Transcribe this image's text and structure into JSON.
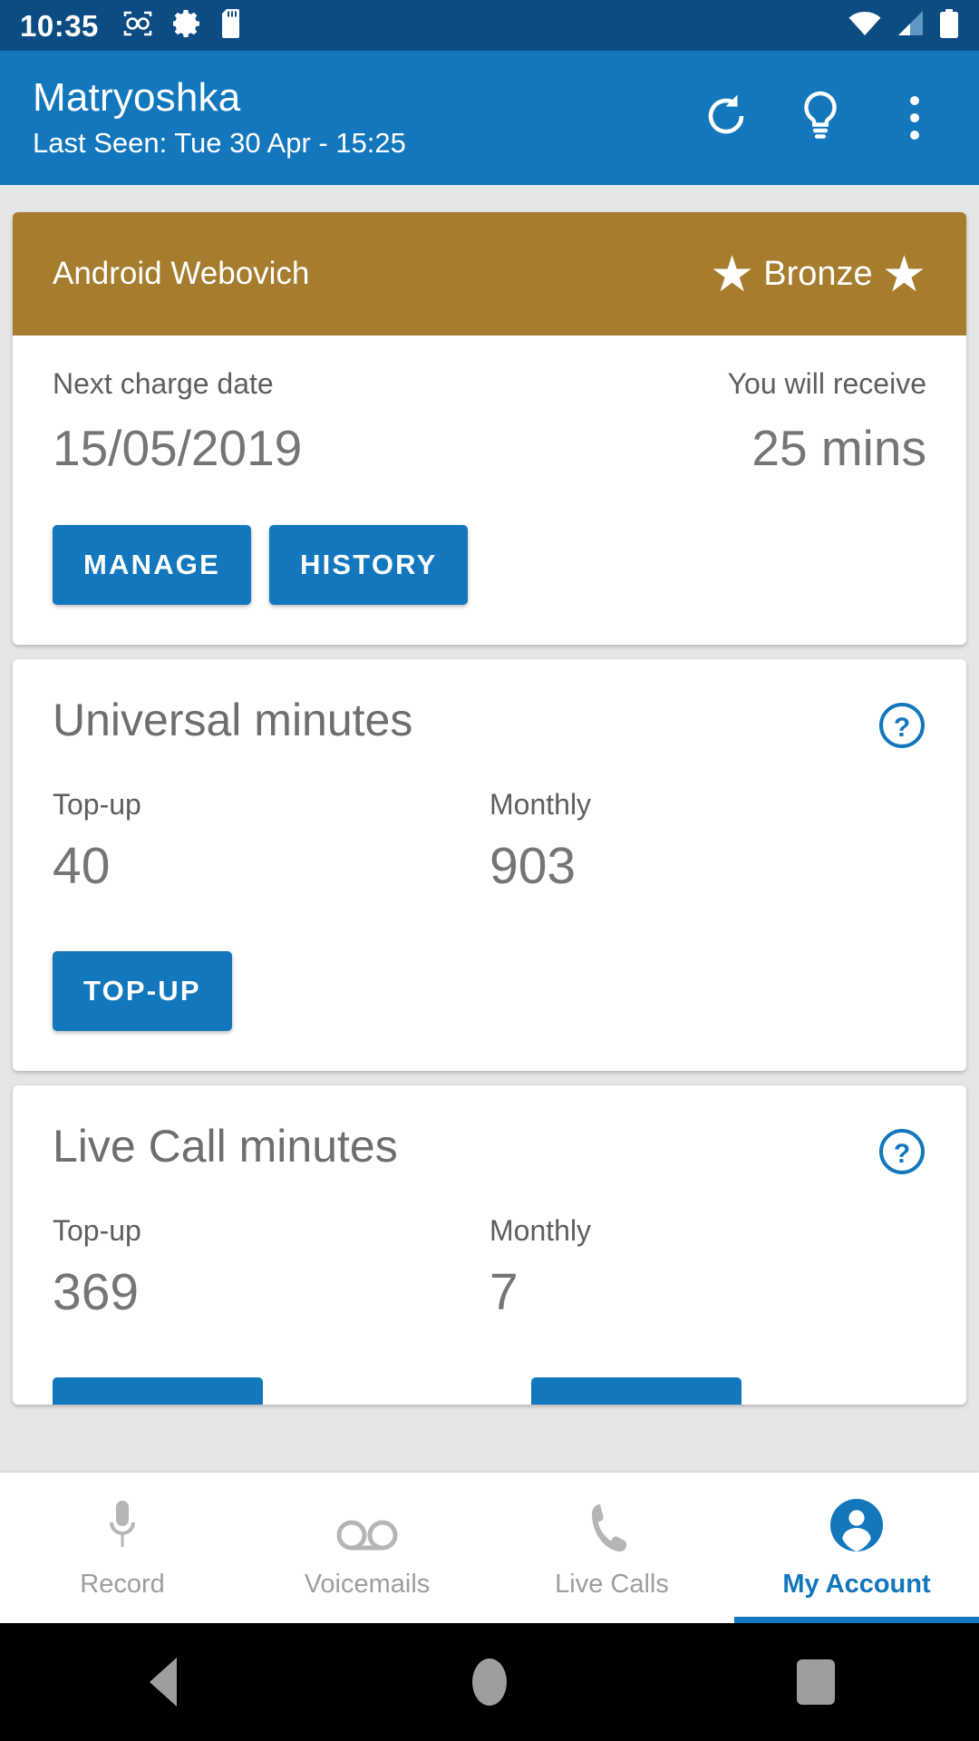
{
  "status_bar": {
    "time": "10:35",
    "left_icons": [
      "voicemail-icon",
      "gear-icon",
      "sd-card-icon"
    ],
    "right_icons": [
      "wifi-icon",
      "cellular-signal-icon",
      "battery-icon"
    ],
    "background_color": "#0B4C82"
  },
  "app_bar": {
    "title": "Matryoshka",
    "subtitle": "Last Seen: Tue 30 Apr - 15:25",
    "background_color": "#1277BC",
    "actions": [
      {
        "name": "refresh-icon",
        "label": "Refresh"
      },
      {
        "name": "lightbulb-icon",
        "label": "Tips"
      },
      {
        "name": "overflow-menu-icon",
        "label": "More options"
      }
    ]
  },
  "plan_card": {
    "account_name": "Android Webovich",
    "tier_label": "Bronze",
    "tier_color": "#A67C2E",
    "next_charge_label": "Next charge date",
    "next_charge_value": "15/05/2019",
    "receive_label": "You will receive",
    "receive_value": "25 mins",
    "manage_label": "MANAGE",
    "history_label": "HISTORY"
  },
  "universal_minutes": {
    "title": "Universal minutes",
    "help_icon": "help-circle-icon",
    "topup_label": "Top-up",
    "topup_value": "40",
    "monthly_label": "Monthly",
    "monthly_value": "903",
    "button_label": "TOP-UP"
  },
  "live_call_minutes": {
    "title": "Live Call minutes",
    "help_icon": "help-circle-icon",
    "topup_label": "Top-up",
    "topup_value": "369",
    "monthly_label": "Monthly",
    "monthly_value": "7"
  },
  "tab_bar": {
    "accent_color": "#1277BC",
    "inactive_color": "#9E9E9E",
    "tabs": [
      {
        "label": "Record",
        "icon": "microphone-icon",
        "active": false
      },
      {
        "label": "Voicemails",
        "icon": "voicemail-icon",
        "active": false
      },
      {
        "label": "Live Calls",
        "icon": "phone-icon",
        "active": false
      },
      {
        "label": "My Account",
        "icon": "person-icon",
        "active": true
      }
    ]
  },
  "system_nav": {
    "back": "back-button",
    "home": "home-button",
    "recents": "recents-button"
  }
}
